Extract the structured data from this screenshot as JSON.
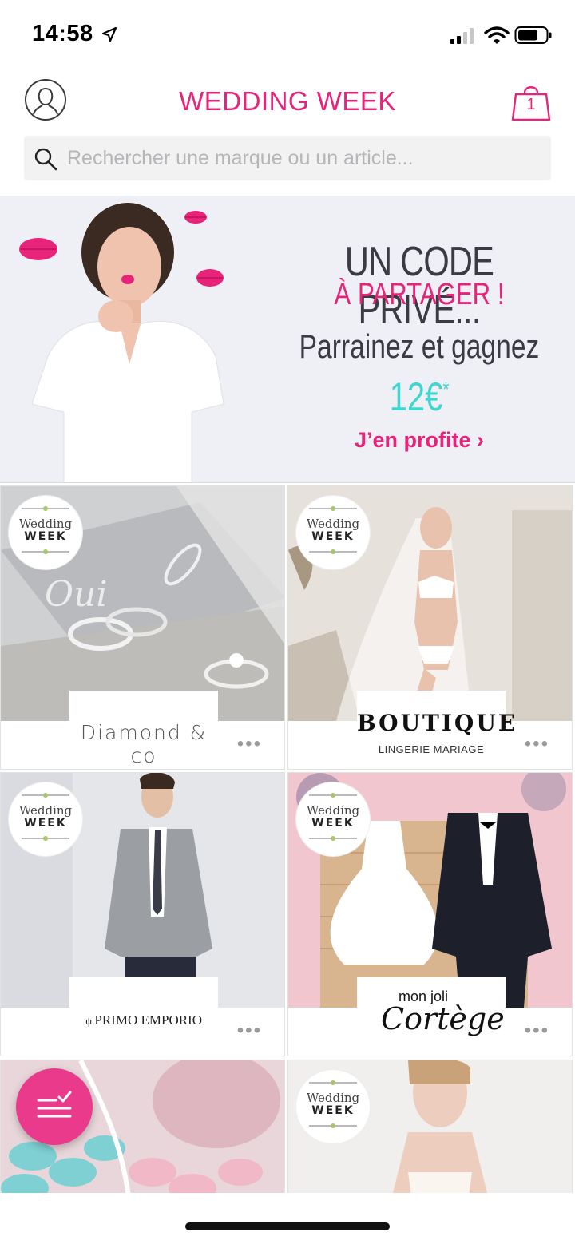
{
  "status_bar": {
    "time": "14:58"
  },
  "header": {
    "title": "WEDDING WEEK",
    "cart_count": "1"
  },
  "search": {
    "placeholder": "Rechercher une marque ou un article..."
  },
  "promo": {
    "line1": "UN CODE PRIVÉ...",
    "line2": "À PARTAGER !",
    "line3": "Parrainez et gagnez",
    "amount": "12€",
    "amount_mark": "*",
    "cta": "J’en profite ›"
  },
  "badge": {
    "line1": "Wedding",
    "line2": "WEEK"
  },
  "tiles": [
    {
      "brand": "Diamond & co",
      "more": "•••"
    },
    {
      "brand_title": "BOUTIQUE",
      "brand_subtitle": "LINGERIE MARIAGE",
      "more": "•••"
    },
    {
      "brand": "PRIMO EMPORIO",
      "more": "•••"
    },
    {
      "brand_small": "mon joli",
      "brand_script": "Cortège",
      "more": "•••"
    }
  ],
  "colors": {
    "accent": "#e8247a",
    "teal": "#3fd6d0",
    "fab": "#ea3a8c"
  }
}
